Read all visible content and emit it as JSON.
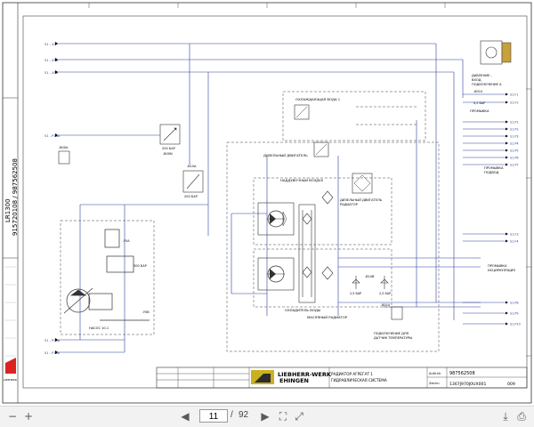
{
  "drawing": {
    "rotated_title": "LR1300",
    "rotated_subtitle": "915720108 / 987562508",
    "logo_text": "LIEBHERR",
    "left_inputs": [
      "51 - X2",
      "51 - X1b",
      "51 - X1a",
      "51 - P1Sa",
      "51 - P2Sa",
      "51 - P1Sb"
    ],
    "right_top_label": "ДАВЛЕНИЕ -\nВХОД\nПОДКЛЮЧЕНИЕ А",
    "right_ports_top": [
      "S1.F1",
      "S1.F2"
    ],
    "right_ports_top_caption": "ПРОМЫВКА",
    "right_ports_group": [
      "S1.P1",
      "S1.P2",
      "S1.P3",
      "S1.P4",
      "S1.P5",
      "S1.P6",
      "S1.P7"
    ],
    "right_ports_group_caption": "ПРОМЫВКА\nПОДВОД",
    "right_ports_mid": [
      "S1.F3",
      "S1.F4"
    ],
    "right_ports_mid_caption": "ПРОМЫВКА\nИСЦИРКУЛЯЦИЯ",
    "right_ports_bottom": [
      "S1.P8",
      "S1.P9",
      "S1.P10"
    ],
    "labels": {
      "cooling_water": "ОХЛАЖДАЮЩАЯ ВОДА 1",
      "diesel_engine": "ДИЗЕЛЬНЫЙ ДВИГАТЕЛЬ",
      "charge_air": "НАДДУВОЧНЫЙ ВОЗДУХ",
      "diesel_radiator": "ДИЗЕЛЬНЫЙ ДВИГАТЕЛЬ\nРАДИАТОР",
      "water_cooler": "ОХЛАДИТЕЛЬ ВОДЫ",
      "oil_radiator": "МАСЛЯНЫЙ РАДИАТОР",
      "temp_sensor": "ПОДКЛЮЧЕНИЕ ДЛЯ\nДАТЧИК ТЕМПЕРАТУРЫ",
      "pump": "НАСОС 10.1",
      "bar_200": "200 БАР",
      "bar_25a": "2,5 БАР",
      "bar_25b": "2,5 БАР",
      "bar_300": "300 БАР",
      "bar_02": "0,2 БАР",
      "tag_b00n": "-B00N",
      "tag_b10a": "-B10A",
      "tag_b10b": "-B10B",
      "tag_y5a": "-Y5A",
      "tag_y5b": "-Y5B",
      "tag_b00a": "-B00A",
      "tag_b010": "-B010"
    },
    "title_block": {
      "company": "LIEBHERR-WERK\nEHINGEN",
      "drawing_title_1": "РАДИАТОР АГРЕГАТ 1",
      "drawing_title_2": "ГИДРАВЛИЧЕСКАЯ СИСТЕМА",
      "drawing_number": "987562508",
      "sheet_ref": "1367J970J0UX001",
      "sheet_no": "009",
      "row1_label": "Auftr.Nr.",
      "row2_label": "Zeichn."
    }
  },
  "toolbar": {
    "prev_page_icon": "◀",
    "page_current": "11",
    "page_separator": "/",
    "page_total": "92",
    "next_page_icon": "▶"
  }
}
